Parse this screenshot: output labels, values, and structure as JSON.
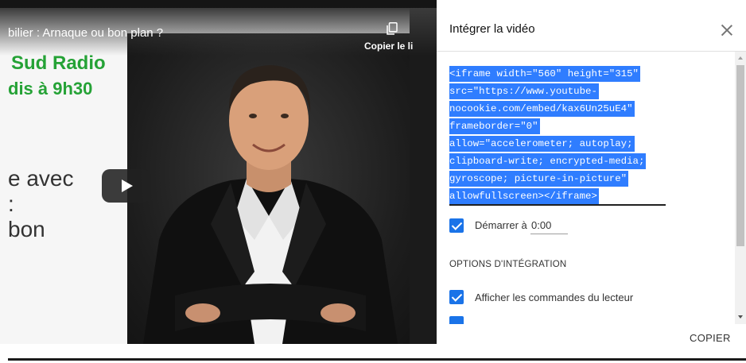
{
  "video": {
    "title": "bilier : Arnaque ou bon plan ?",
    "green_line1": "Sud Radio",
    "green_line2": "dis à 9h30",
    "text_line1": "e avec",
    "text_line2": ":",
    "text_line3": "bon",
    "copy_label": "Copier le li",
    "play_icon": "play-icon",
    "copy_icon": "copy-icon"
  },
  "dialog": {
    "title": "Intégrer la vidéo",
    "close_icon": "close-icon",
    "code_lines": [
      "<iframe width=\"560\" height=\"315\"",
      "src=\"https://www.youtube-",
      "nocookie.com/embed/kax6Un25uE4\"",
      "frameborder=\"0\"",
      "allow=\"accelerometer; autoplay;",
      "clipboard-write; encrypted-media;",
      "gyroscope; picture-in-picture\"",
      "allowfullscreen></iframe>"
    ],
    "start_label": "Démarrer à",
    "start_value": "0:00",
    "options_heading": "OPTIONS D'INTÉGRATION",
    "option_controls": "Afficher les commandes du lecteur",
    "copy_button": "COPIER"
  },
  "colors": {
    "accent": "#1a73e8",
    "selection": "#2f7dff",
    "green_text": "#25a236"
  }
}
